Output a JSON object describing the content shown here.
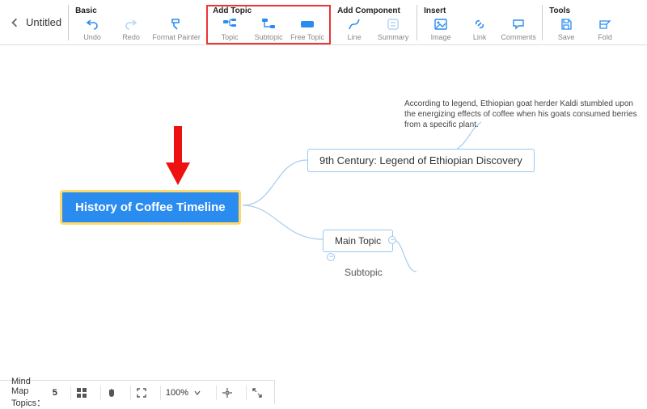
{
  "document": {
    "title": "Untitled"
  },
  "toolbar": {
    "groups": {
      "basic": {
        "label": "Basic",
        "undo": "Undo",
        "redo": "Redo",
        "format_painter": "Format Painter"
      },
      "add_topic": {
        "label": "Add Topic",
        "topic": "Topic",
        "subtopic": "Subtopic",
        "free_topic": "Free Topic"
      },
      "add_component": {
        "label": "Add Component",
        "line": "Line",
        "summary": "Summary"
      },
      "insert": {
        "label": "Insert",
        "image": "Image",
        "link": "Link",
        "comments": "Comments"
      },
      "tools": {
        "label": "Tools",
        "save": "Save",
        "fold": "Fold"
      }
    }
  },
  "mindmap": {
    "central": "History of Coffee Timeline",
    "topic1": "9th Century: Legend of Ethiopian Discovery",
    "topic1_note": "According to legend, Ethiopian goat herder Kaldi stumbled upon the energizing effects of coffee when his goats consumed berries from a specific plant.",
    "topic2": "Main Topic",
    "subtopic2": "Subtopic"
  },
  "statusbar": {
    "label": "Mind Map Topics：",
    "count": "5",
    "zoom": "100%"
  },
  "colors": {
    "accent": "#2b8cf0",
    "highlight_border": "#e33",
    "selection_ring": "#ffd86b"
  }
}
